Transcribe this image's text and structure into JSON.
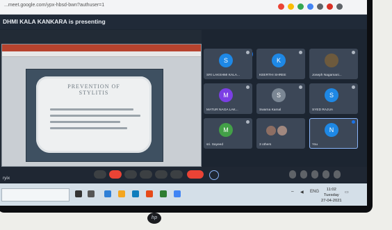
{
  "browser": {
    "url": "...meet.google.com/ypx-hbsd-bwn?authuser=1",
    "extension_colors": [
      "#ea4335",
      "#fbbc04",
      "#34a853",
      "#4285f4",
      "#5f6368",
      "#d93025",
      "#5f6368"
    ]
  },
  "meeting": {
    "presenter_banner": "DHMI KALA KANKARA is presenting",
    "time_code": "ryix"
  },
  "slide": {
    "title": "PREVENTION OF\nSTYLITIS",
    "bullet_count": 4
  },
  "participants": [
    {
      "initial": "S",
      "name": "SRI LAKSHMI KALA...",
      "avatar_color": "#1e88e5"
    },
    {
      "initial": "K",
      "name": "KEERTHI SHREE",
      "avatar_color": "#1e88e5"
    },
    {
      "initial": "",
      "name": "Joseph Nagamani...",
      "avatar_color": "#6d5a3d"
    },
    {
      "initial": "M",
      "name": "MATUR NAGA LAK...",
      "avatar_color": "#7b3fe4"
    },
    {
      "initial": "S",
      "name": "Swarna Kamal",
      "avatar_color": "#7b8794"
    },
    {
      "initial": "S",
      "name": "SYED RAJUA",
      "avatar_color": "#1e88e5"
    },
    {
      "initial": "M",
      "name": "sri. Sayeed",
      "avatar_color": "#43a047"
    },
    {
      "initial": "",
      "name": "3 others",
      "avatar_color": "#8d6e63"
    },
    {
      "initial": "N",
      "name": "You",
      "avatar_color": "#1e88e5"
    }
  ],
  "controls": [
    {
      "icon": "mic-icon",
      "color": "#3c4043"
    },
    {
      "icon": "camera-off-icon",
      "color": "#ea4335"
    },
    {
      "icon": "captions-icon",
      "color": "#3c4043"
    },
    {
      "icon": "raise-hand-icon",
      "color": "#3c4043"
    },
    {
      "icon": "present-icon",
      "color": "#3c4043"
    },
    {
      "icon": "more-icon",
      "color": "#3c4043"
    },
    {
      "icon": "leave-call-icon",
      "color": "#ea4335"
    }
  ],
  "taskbar": {
    "search_placeholder": "",
    "time": "11:02",
    "day": "Tuesday",
    "date": "27-04-2021",
    "lang": "ENG",
    "app_colors": [
      "#2f7fd6",
      "#f4a620",
      "#0f7dbd",
      "#e64a19",
      "#2e7d32",
      "#4285f4"
    ]
  }
}
